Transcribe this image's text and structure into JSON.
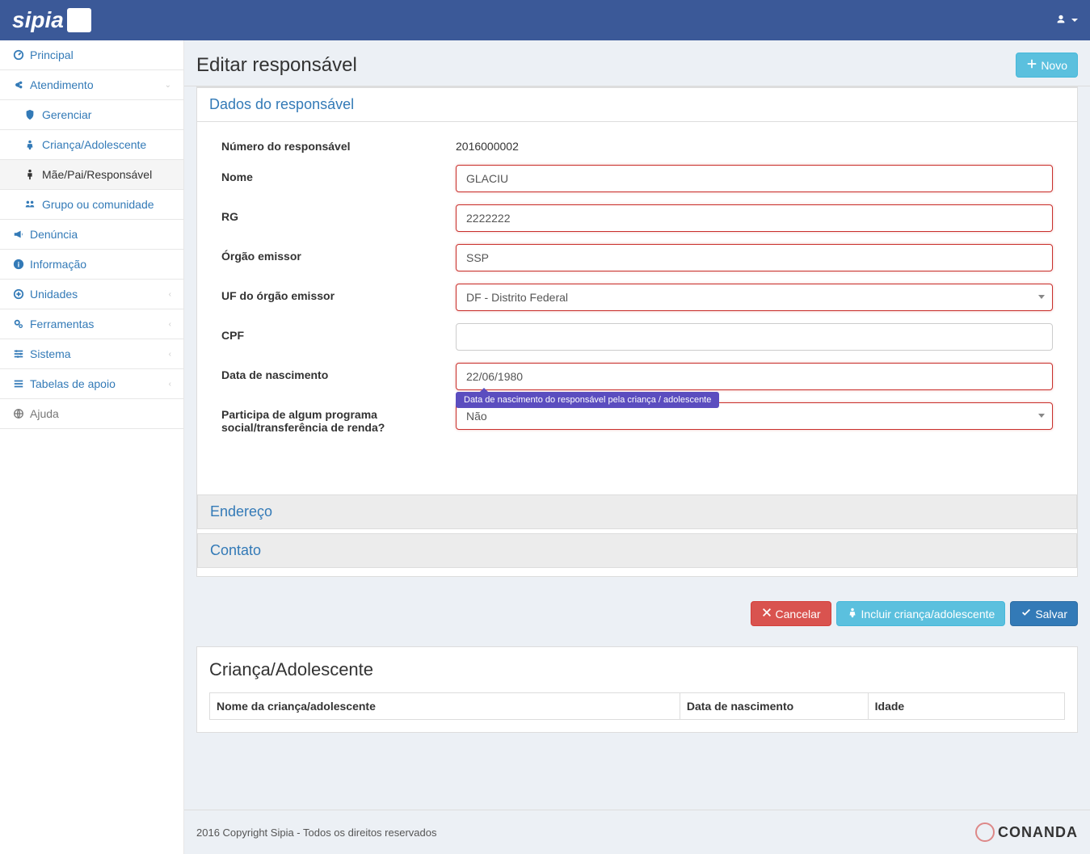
{
  "brand": "sipia",
  "page_title": "Editar responsável",
  "new_button": "Novo",
  "sidebar": {
    "principal": "Principal",
    "atendimento": "Atendimento",
    "gerenciar": "Gerenciar",
    "crianca": "Criança/Adolescente",
    "responsavel": "Mãe/Pai/Responsável",
    "grupo": "Grupo ou comunidade",
    "denuncia": "Denúncia",
    "informacao": "Informação",
    "unidades": "Unidades",
    "ferramentas": "Ferramentas",
    "sistema": "Sistema",
    "tabelas": "Tabelas de apoio",
    "ajuda": "Ajuda"
  },
  "sections": {
    "dados": "Dados do responsável",
    "endereco": "Endereço",
    "contato": "Contato"
  },
  "form": {
    "numero_label": "Número do responsável",
    "numero_value": "2016000002",
    "nome_label": "Nome",
    "nome_value": "GLACIU",
    "rg_label": "RG",
    "rg_value": "2222222",
    "orgao_label": "Órgão emissor",
    "orgao_value": "SSP",
    "uf_label": "UF do órgão emissor",
    "uf_value": "DF - Distrito Federal",
    "cpf_label": "CPF",
    "cpf_value": "",
    "nascimento_label": "Data de nascimento",
    "nascimento_value": "22/06/1980",
    "nascimento_tooltip": "Data de nascimento do responsável pela criança / adolescente",
    "programa_label": "Participa de algum programa social/transferência de renda?",
    "programa_value": "Não"
  },
  "buttons": {
    "cancelar": "Cancelar",
    "incluir": "Incluir criança/adolescente",
    "salvar": "Salvar"
  },
  "table": {
    "title": "Criança/Adolescente",
    "col_nome": "Nome da criança/adolescente",
    "col_nascimento": "Data de nascimento",
    "col_idade": "Idade"
  },
  "footer": {
    "copyright": "2016 Copyright Sipia - Todos os direitos reservados",
    "logo": "CONANDA"
  }
}
